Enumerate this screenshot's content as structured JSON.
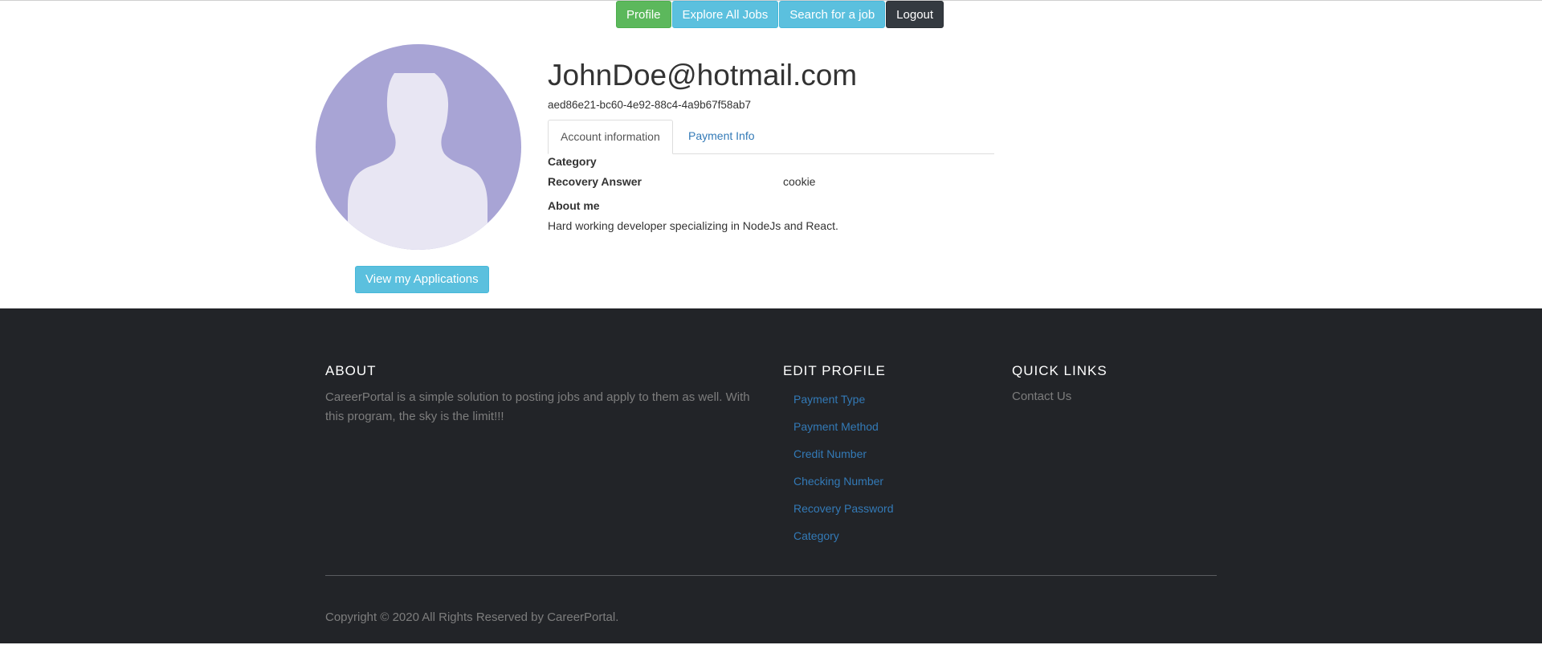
{
  "nav": {
    "profile_label": "Profile",
    "explore_label": "Explore All Jobs",
    "search_label": "Search for a job",
    "logout_label": "Logout"
  },
  "profile": {
    "email": "JohnDoe@hotmail.com",
    "user_id": "aed86e21-bc60-4e92-88c4-4a9b67f58ab7",
    "avatar_icon": "user-silhouette-icon",
    "view_applications_label": "View my Applications"
  },
  "tabs": [
    {
      "label": "Account information",
      "active": true
    },
    {
      "label": "Payment Info",
      "active": false
    }
  ],
  "account": {
    "category_label": "Category",
    "category_value": "",
    "recovery_label": "Recovery Answer",
    "recovery_value": "cookie",
    "about_label": "About me",
    "about_value": "Hard working developer specializing in NodeJs and React."
  },
  "footer": {
    "about_heading": "ABOUT",
    "about_text": "CareerPortal is a simple solution to posting jobs and apply to them as well. With this program, the sky is the limit!!!",
    "edit_heading": "EDIT PROFILE",
    "edit_links": [
      "Payment Type",
      "Payment Method",
      "Credit Number",
      "Checking Number",
      "Recovery Password",
      "Category"
    ],
    "quick_heading": "QUICK LINKS",
    "quick_links": [
      "Contact Us"
    ],
    "copyright": "Copyright © 2020 All Rights Reserved by CareerPortal."
  },
  "colors": {
    "success": "#5cb85c",
    "info": "#5bc0de",
    "dark": "#343a40",
    "link": "#337ab7",
    "footer_bg": "#222428",
    "avatar_bg": "#a8a4d5"
  }
}
